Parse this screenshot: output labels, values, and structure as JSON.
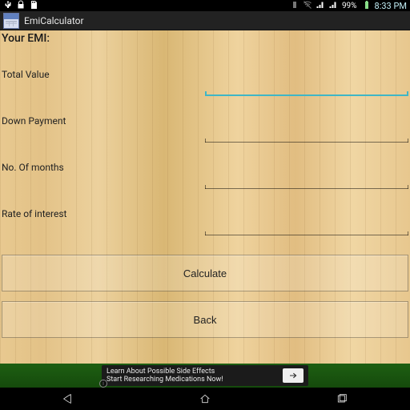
{
  "status": {
    "battery_pct": "99%",
    "clock": "8:33 PM"
  },
  "app": {
    "title": "EmiCalculator"
  },
  "emi": {
    "heading": "Your EMI:",
    "fields": {
      "total_value": {
        "label": "Total Value",
        "value": ""
      },
      "down_payment": {
        "label": "Down Payment",
        "value": ""
      },
      "months": {
        "label": "No. Of months",
        "value": ""
      },
      "rate": {
        "label": "Rate of interest",
        "value": ""
      }
    },
    "buttons": {
      "calculate": "Calculate",
      "back": "Back"
    }
  },
  "ad": {
    "line1": "Learn About Possible Side Effects",
    "line2": "Start Researching Medications Now!"
  }
}
